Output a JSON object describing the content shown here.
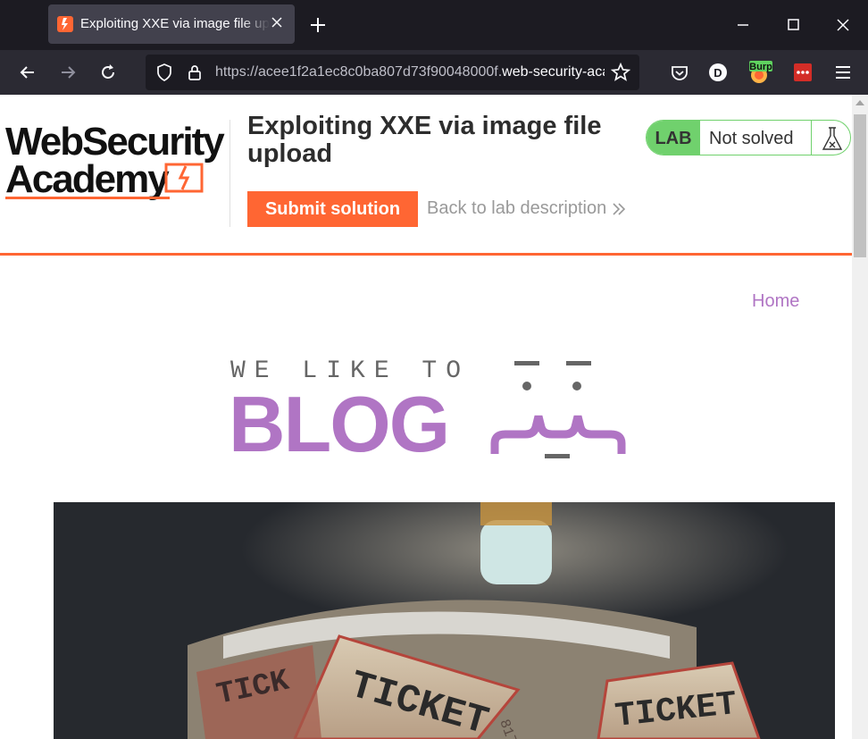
{
  "browser": {
    "tab": {
      "title": "Exploiting XXE via image file upload",
      "favicon": "portswigger-icon"
    },
    "url": {
      "prefix": "https://acee1f2a1ec8c0ba807d73f90048000f.",
      "domain": "web-security-academy.net"
    },
    "extensions": [
      "pocket-icon",
      "dashlane-icon",
      "burp-extension-icon",
      "lastpass-icon"
    ],
    "extension_badge": "Burp"
  },
  "lab": {
    "logo": {
      "line1": "WebSecurity",
      "line2": "Academy"
    },
    "title": "Exploiting XXE via image file upload",
    "submit_label": "Submit solution",
    "back_label": "Back to lab description",
    "status": {
      "tag": "LAB",
      "text": "Not solved"
    }
  },
  "site": {
    "nav": {
      "home": "Home"
    },
    "banner": {
      "sub": "WE LIKE TO",
      "word": "BLOG"
    },
    "hero_image": "ticket-roll-photo"
  },
  "colors": {
    "accent": "#ff6633",
    "blog_purple": "#b075c4",
    "lab_green": "#70d16d"
  }
}
